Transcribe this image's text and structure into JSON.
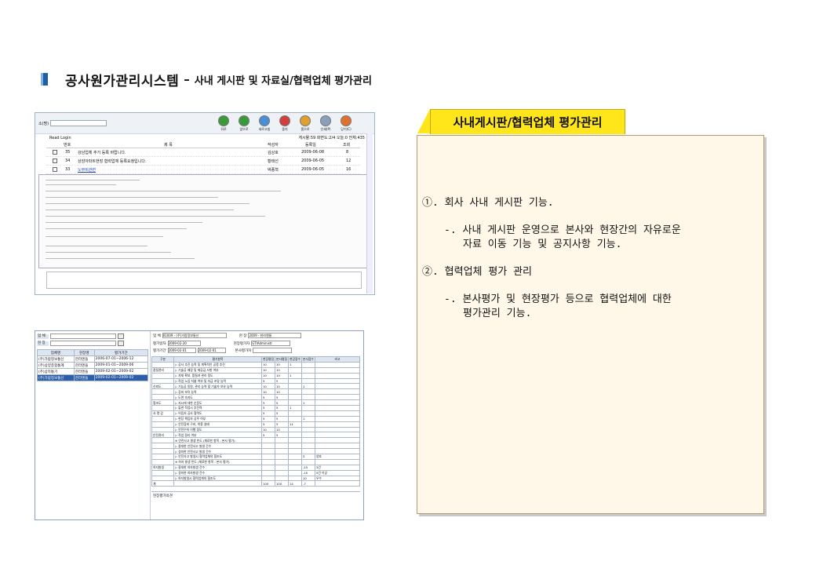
{
  "header": {
    "title_main": "공사원가관리시스템",
    "separator": "–",
    "title_sub": "사내 게시판 및 자료실/협력업체 평가관리"
  },
  "board_screenshot": {
    "search_label": "소(명)",
    "toolbar": [
      "뒤로",
      "앞으로",
      "새로고침",
      "중지",
      "홈으로",
      "인쇄(P)",
      "닫기(C)"
    ],
    "read_login": "Read Login",
    "status": "게시물:59 화면도:2/4 오늘:0 전체:435",
    "columns": [
      "번호",
      "제 목",
      "작성자",
      "등록일",
      "조회"
    ],
    "rows": [
      {
        "no": "35",
        "title": "강남업체 추가 등록 바랍니다.",
        "author": "김상호",
        "date": "2009-06-08",
        "views": "8"
      },
      {
        "no": "34",
        "title": "상암아파트현장 협력업체 등록요청입니다.",
        "author": "황태선",
        "date": "2009-06-05",
        "views": "12"
      },
      {
        "no": "33",
        "title": "노무비관련",
        "author": "박종혁",
        "date": "2009-06-05",
        "views": "16"
      }
    ]
  },
  "eval_screenshot": {
    "left_fields": [
      {
        "label": "업 체"
      },
      {
        "label": "현 장"
      }
    ],
    "grid_columns": [
      "업체명",
      "현장명",
      "평가기간"
    ],
    "grid_rows": [
      {
        "company": "(주)가람정보통신",
        "site": "한라엔들",
        "period": "2006-07-01~2006-12",
        "selected": false
      },
      {
        "company": "(주)삼양종합통계",
        "site": "한라엔들",
        "period": "2009-01-01~2009-06",
        "selected": false
      },
      {
        "company": "(주)삼목통기",
        "site": "한라엔들",
        "period": "2009-02-01~2009-02",
        "selected": false
      },
      {
        "company": "(주)가람정보통신",
        "site": "한라엔들",
        "period": "2009-02-01~2009-02",
        "selected": true
      }
    ],
    "top_company_label": "업 체",
    "top_company_value": "01009 - (주)가람정보통신",
    "top_site_label": "현 장",
    "top_site_value": "2009 - 한라엔들",
    "eval_date_label": "평가일자",
    "eval_date_value": "2009-02-20",
    "site_evaluator_label": "현장평가자",
    "site_evaluator_value": "GTIAdministr",
    "period_label": "평가기간",
    "period_from": "2009-02-01",
    "period_to": "2009-02-01",
    "hq_evaluator_label": "본사평가자",
    "table_columns": [
      "구분",
      "평가항목",
      "현장평점",
      "본사평점",
      "현장점수",
      "본사점수",
      "비고"
    ],
    "table_rows": [
      {
        "cat": "",
        "item": "▷ 공사 추진 능력 및 계획적인 공정 추진",
        "a": "10",
        "b": "10",
        "c": "1",
        "d": "",
        "note": ""
      },
      {
        "cat": "품질관리",
        "item": "▷ 기술공 배정 및 재공급 사항 여부",
        "a": "10",
        "b": "10",
        "c": "",
        "d": "",
        "note": ""
      },
      {
        "cat": "",
        "item": "▷ 자재 확보, 품질과 관리 정도",
        "a": "10",
        "b": "10",
        "c": "1",
        "d": "",
        "note": ""
      },
      {
        "cat": "",
        "item": "▷ 작업 노임 지불 여부 및 자금 조달 능력",
        "a": "5",
        "b": "5",
        "c": "",
        "d": "",
        "note": ""
      },
      {
        "cat": "신뢰도",
        "item": "▷ 기능공 동원, 관리 능력 및 기술자 보유 능력",
        "a": "10",
        "b": "10",
        "c": "",
        "d": "1",
        "note": ""
      },
      {
        "cat": "",
        "item": "▷ 장비 보유 능력",
        "a": "10",
        "b": "10",
        "c": "",
        "d": "",
        "note": ""
      },
      {
        "cat": "",
        "item": "▷ 도면 숙지도",
        "a": "5",
        "b": "5",
        "c": "",
        "d": "",
        "note": ""
      },
      {
        "cat": "협조도",
        "item": "▷ 지시에 대한 순응도",
        "a": "5",
        "b": "5",
        "c": "",
        "d": "1",
        "note": ""
      },
      {
        "cat": "",
        "item": "▷ 돌관 작업시 추진력",
        "a": "5",
        "b": "5",
        "c": "1",
        "d": "",
        "note": ""
      },
      {
        "cat": "사 명 감",
        "item": "▷ 어음처 공사 협력도",
        "a": "5",
        "b": "5",
        "c": "",
        "d": "",
        "note": ""
      },
      {
        "cat": "",
        "item": "▷ 현장 책임자 상주 여부",
        "a": "5",
        "b": "5",
        "c": "",
        "d": "1",
        "note": ""
      },
      {
        "cat": "",
        "item": "▷ 안전장비 구비, 착용 실태",
        "a": "5",
        "b": "5",
        "c": "11",
        "d": "",
        "note": ""
      },
      {
        "cat": "",
        "item": "▷ 안전수칙 이행 정도",
        "a": "10",
        "b": "10",
        "c": "",
        "d": "",
        "note": ""
      },
      {
        "cat": "안전관리",
        "item": "▷ 작업 정리 여부",
        "a": "5",
        "b": "5",
        "c": "",
        "d": "",
        "note": ""
      },
      {
        "cat": "",
        "item": "※ 안전사고 발생 빈도 (체료한 항목 - 본사 평가)",
        "a": "",
        "b": "",
        "c": "",
        "d": "",
        "note": ""
      },
      {
        "cat": "",
        "item": "▷ 중대한 안전사고 발생 건수",
        "a": "",
        "b": "",
        "c": "",
        "d": "",
        "note": ""
      },
      {
        "cat": "",
        "item": "▷ 경미한 안전사고 발생 건수",
        "a": "",
        "b": "",
        "c": "",
        "d": "",
        "note": ""
      },
      {
        "cat": "",
        "item": "▷ 안전사고 발생시 협력업체의 협조도",
        "a": "",
        "b": "",
        "c": "",
        "d": "5",
        "note": "양호"
      },
      {
        "cat": "",
        "item": "※ 하자 발생 빈도 (체료한 항목 - 본사 평가)",
        "a": "",
        "b": "",
        "c": "",
        "d": "",
        "note": ""
      },
      {
        "cat": "하자발생",
        "item": "▷ 중대한 하자발생 건수",
        "a": "",
        "b": "",
        "c": "",
        "d": "-15",
        "note": "3건"
      },
      {
        "cat": "",
        "item": "▷ 경미한 하자발생 건수",
        "a": "",
        "b": "",
        "c": "",
        "d": "-10",
        "note": "5건 이상"
      },
      {
        "cat": "",
        "item": "▷ 하자발생시 협력업체의 협조도",
        "a": "",
        "b": "",
        "c": "",
        "d": "10",
        "note": "우수"
      },
      {
        "cat": "계",
        "item": "",
        "a": "100",
        "b": "100",
        "c": "14",
        "d": "-7",
        "note": ""
      }
    ],
    "footer_label": "현장평가의견"
  },
  "panel": {
    "tab_label": "사내게시판/협력업체 평가관리",
    "item1": "①. 회사 사내 게시판 기능.",
    "item1_sub1": "-. 사내 게시판 운영으로 본사와 현장간의 자유로운",
    "item1_sub2": "자료 이동 기능 및 공지사항 기능.",
    "item2": "②. 협력업체 평가 관리",
    "item2_sub1": "-. 본사평가  및 현장평가 등으로 협력업체에 대한",
    "item2_sub2": "평가관리 기능.",
    "colors": {
      "tab": "#ffe61a",
      "panel_bg": "#fff8e8",
      "panel_border": "#b89a72",
      "title_mark": "#1f5fa8"
    }
  }
}
